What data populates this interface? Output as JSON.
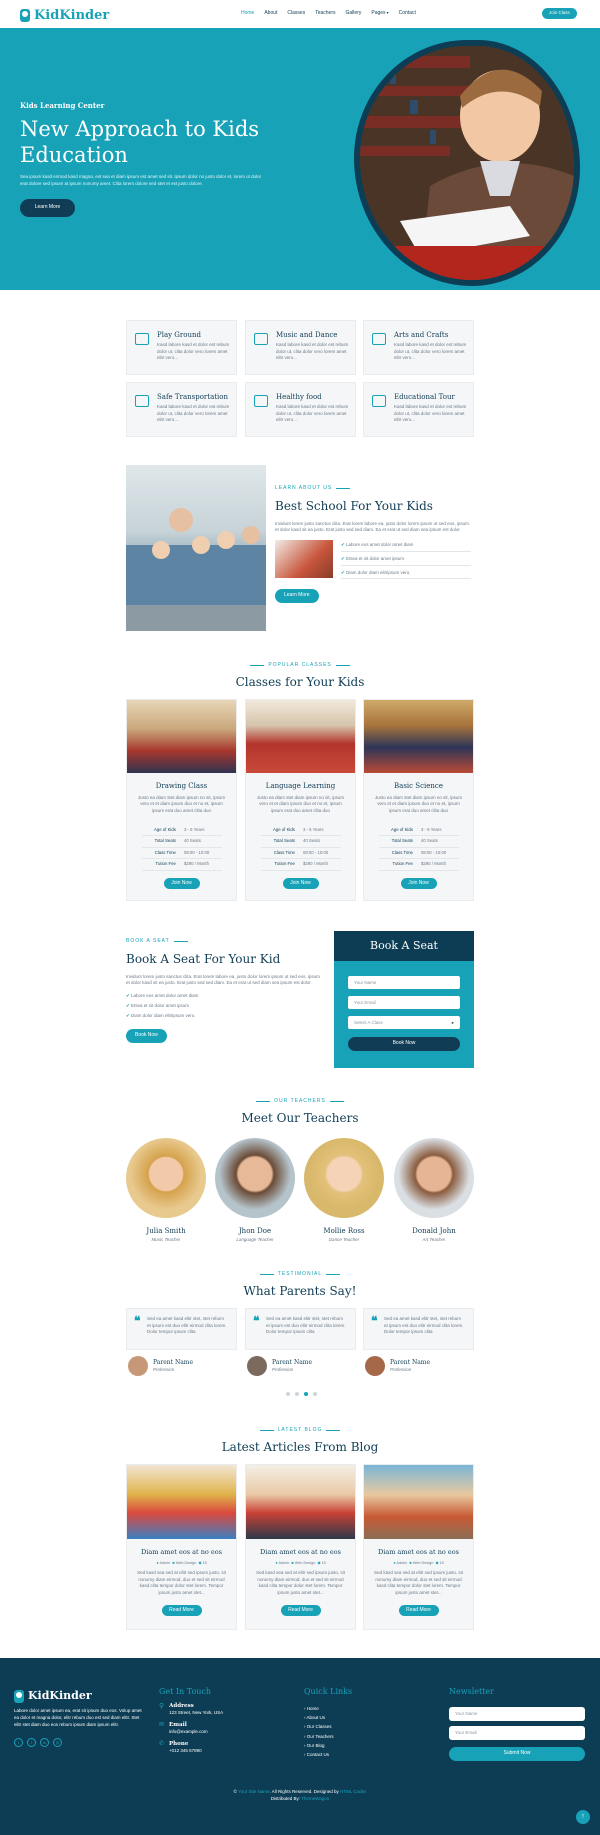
{
  "nav": {
    "brand": "KidKinder",
    "links": [
      "Home",
      "About",
      "Classes",
      "Teachers",
      "Gallery",
      "Pages",
      "Contact"
    ],
    "cta": "Join Class"
  },
  "hero": {
    "tag": "Kids Learning Center",
    "title_line1": "New Approach to Kids",
    "title_line2": "Education",
    "text": "Sea ipsum kasd eirmod kasd magna, est sea et diam ipsum est amet sed sit. Ipsum dolor no justo dolor et, lorem ut dolor erat dolore sed ipsum at ipsum nonumy amet. Clita lorem dolore sed stet et est justo dolore.",
    "button": "Learn More"
  },
  "features": [
    {
      "title": "Play Ground",
      "text": "Kasd labore kasd et dolor est rebum dolor ut, clita dolor vero lorem amet elitr vero..."
    },
    {
      "title": "Music and Dance",
      "text": "Kasd labore kasd et dolor est rebum dolor ut, clita dolor vero lorem amet elitr vero..."
    },
    {
      "title": "Arts and Crafts",
      "text": "Kasd labore kasd et dolor est rebum dolor ut, clita dolor vero lorem amet elitr vero..."
    },
    {
      "title": "Safe Transportation",
      "text": "Kasd labore kasd et dolor est rebum dolor ut, clita dolor vero lorem amet elitr vero..."
    },
    {
      "title": "Healthy food",
      "text": "Kasd labore kasd et dolor est rebum dolor ut, clita dolor vero lorem amet elitr vero..."
    },
    {
      "title": "Educational Tour",
      "text": "Kasd labore kasd et dolor est rebum dolor ut, clita dolor vero lorem amet elitr vero..."
    }
  ],
  "about": {
    "tag": "Learn About Us",
    "title": "Best School For Your Kids",
    "text": "Invidunt lorem justo sanctus clita. Erat lorem labore ea, justo dolor lorem ipsum ut sed eos, ipsum et dolor kasd sit ea justo. Erat justo sed sed diam. Ea et erat ut sed diam sea ipsum est dolor",
    "checks": [
      "Labore eos amet dolor amet diam",
      "Etsea et sit dolor amet ipsum",
      "Diam dolor diam elitripsum vero."
    ],
    "button": "Learn More"
  },
  "classes": {
    "tag": "Popular Classes",
    "title": "Classes for Your Kids",
    "items": [
      {
        "title": "Drawing Class",
        "text": "Justo ea diam stet diam ipsum no sit, ipsum vero et et diam ipsum duo et no et, ipsum ipsum erat duo amet clita duo",
        "rows": [
          [
            "Age of Kids",
            "3 - 6 Years"
          ],
          [
            "Total Seats",
            "40 Seats"
          ],
          [
            "Class Time",
            "08:00 - 10:00"
          ],
          [
            "Tution Fee",
            "$290 / Month"
          ]
        ],
        "button": "Join Now"
      },
      {
        "title": "Language Learning",
        "text": "Justo ea diam stet diam ipsum no sit, ipsum vero et et diam ipsum duo et no et, ipsum ipsum erat duo amet clita duo",
        "rows": [
          [
            "Age of Kids",
            "3 - 6 Years"
          ],
          [
            "Total Seats",
            "40 Seats"
          ],
          [
            "Class Time",
            "08:00 - 10:00"
          ],
          [
            "Tution Fee",
            "$290 / Month"
          ]
        ],
        "button": "Join Now"
      },
      {
        "title": "Basic Science",
        "text": "Justo ea diam stet diam ipsum no sit, ipsum vero et et diam ipsum duo et no et, ipsum ipsum erat duo amet clita duo",
        "rows": [
          [
            "Age of Kids",
            "3 - 6 Years"
          ],
          [
            "Total Seats",
            "40 Seats"
          ],
          [
            "Class Time",
            "08:00 - 10:00"
          ],
          [
            "Tution Fee",
            "$290 / Month"
          ]
        ],
        "button": "Join Now"
      }
    ]
  },
  "booking": {
    "tag": "Book A Seat",
    "title": "Book A Seat For Your Kid",
    "text": "Invidunt lorem justo sanctus clita. Erat lorem labore ea, justo dolor lorem ipsum ut sed eos, ipsum et dolor kasd sit ea justo. Erat justo sed sed diam. Ea et erat ut sed diam sea ipsum est dolor",
    "checks": [
      "Labore eos amet dolor amet diam",
      "Etsea et sit dolor amet ipsum",
      "Diam dolor diam elitripsum vero."
    ],
    "button": "Book Now",
    "form": {
      "title": "Book A Seat",
      "name_ph": "Your Name",
      "email_ph": "Your Email",
      "select": "Select A Class",
      "submit": "Book Now"
    }
  },
  "teachers": {
    "tag": "Our Teachers",
    "title": "Meet Our Teachers",
    "items": [
      {
        "name": "Julia Smith",
        "role": "Music Teacher"
      },
      {
        "name": "Jhon Doe",
        "role": "Language Teacher"
      },
      {
        "name": "Mollie Ross",
        "role": "Dance Teacher"
      },
      {
        "name": "Donald John",
        "role": "Art Teacher"
      }
    ]
  },
  "testimonials": {
    "tag": "Testimonial",
    "title": "What Parents Say!",
    "items": [
      {
        "text": "Sed ea amet kasd elitr stet, stet rebum et ipsum est duo elitr eirmod clita lorem. Dolor tempor ipsum clita",
        "name": "Parent Name",
        "role": "Profession"
      },
      {
        "text": "Sed ea amet kasd elitr stet, stet rebum et ipsum est duo elitr eirmod clita lorem. Dolor tempor ipsum clita",
        "name": "Parent Name",
        "role": "Profession"
      },
      {
        "text": "Sed ea amet kasd elitr stet, stet rebum et ipsum est duo elitr eirmod clita lorem. Dolor tempor ipsum clita",
        "name": "Parent Name",
        "role": "Profession"
      }
    ]
  },
  "blog": {
    "tag": "Latest Blog",
    "title": "Latest Articles From Blog",
    "items": [
      {
        "title": "Diam amet eos at no eos",
        "author": "Admin",
        "category": "Web Design",
        "comments": "15",
        "text": "Sed kasd sea sed at elitr sed ipsum justo, sit nonumy diam eirmod, duo et sed sit eirmod kasd clita tempor dolor stet lorem. Tempor ipsum justo amet stet...",
        "button": "Read More"
      },
      {
        "title": "Diam amet eos at no eos",
        "author": "Admin",
        "category": "Web Design",
        "comments": "15",
        "text": "Sed kasd sea sed at elitr sed ipsum justo, sit nonumy diam eirmod, duo et sed sit eirmod kasd clita tempor dolor stet lorem. Tempor ipsum justo amet stet...",
        "button": "Read More"
      },
      {
        "title": "Diam amet eos at no eos",
        "author": "Admin",
        "category": "Web Design",
        "comments": "15",
        "text": "Sed kasd sea sed at elitr sed ipsum justo, sit nonumy diam eirmod, duo et sed sit eirmod kasd clita tempor dolor stet lorem. Tempor ipsum justo amet stet...",
        "button": "Read More"
      }
    ]
  },
  "footer": {
    "brand": "KidKinder",
    "about": "Labore dolor amet ipsum ea, erat sit ipsum duo eos. Volup amet ea dolor et magna dolor, elitr rebum duo est sed diam elitr. Stet elitr stet diam duo eos rebum ipsum diam ipsum elitr.",
    "contact_title": "Get In Touch",
    "address_label": "Address",
    "address": "123 Street, New York, USA",
    "email_label": "Email",
    "email": "info@example.com",
    "phone_label": "Phone",
    "phone": "+012 345 67890",
    "links_title": "Quick Links",
    "links": [
      "Home",
      "About Us",
      "Our Classes",
      "Our Teachers",
      "Our Blog",
      "Contact Us"
    ],
    "newsletter_title": "Newsletter",
    "name_ph": "Your Name",
    "email_ph": "Your Email",
    "submit": "Submit Now",
    "copyright_a": "©",
    "site_name": "Your Site Name",
    "copyright_b": ". All Rights Reserved. Designed by",
    "designer": "HTML Codex",
    "distributed": "Distributed By:",
    "distributor": "ThemeWagon"
  },
  "colors": {
    "primary": "#17a2b8",
    "dark": "#103d55"
  }
}
